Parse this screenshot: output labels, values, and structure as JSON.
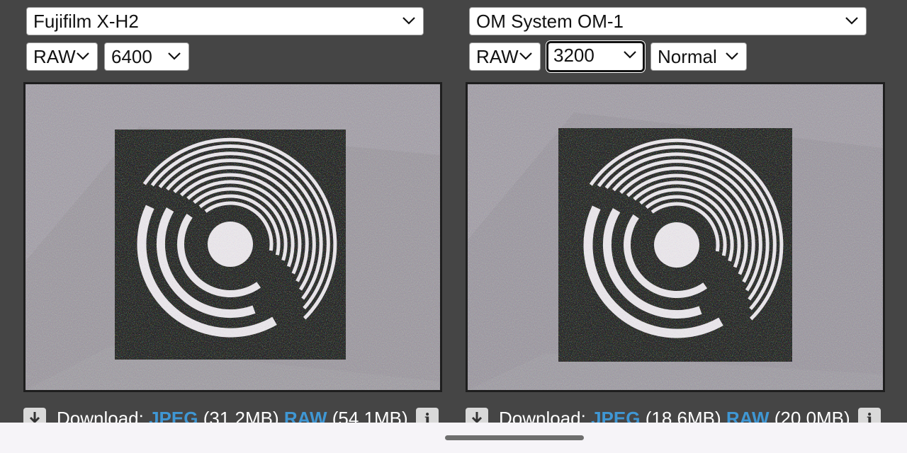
{
  "left_panel": {
    "camera": "Fujifilm X-H2",
    "format": "RAW",
    "iso": "6400",
    "download": {
      "label": "Download:",
      "jpeg_label": "JPEG",
      "jpeg_size": "(31.2MB)",
      "raw_label": "RAW",
      "raw_size": "(54.1MB)"
    }
  },
  "right_panel": {
    "camera": "OM System OM-1",
    "format": "RAW",
    "iso": "3200",
    "mode": "Normal",
    "download": {
      "label": "Download:",
      "jpeg_label": "JPEG",
      "jpeg_size": "(18.6MB)",
      "raw_label": "RAW",
      "raw_size": "(20.0MB)"
    }
  },
  "icons": {
    "download": "download-arrow-icon",
    "info": "info-icon",
    "chevron": "chevron-down-icon"
  },
  "colors": {
    "background": "#454545",
    "link": "#3f97d4",
    "photo_gray": "#9f9ca1"
  }
}
